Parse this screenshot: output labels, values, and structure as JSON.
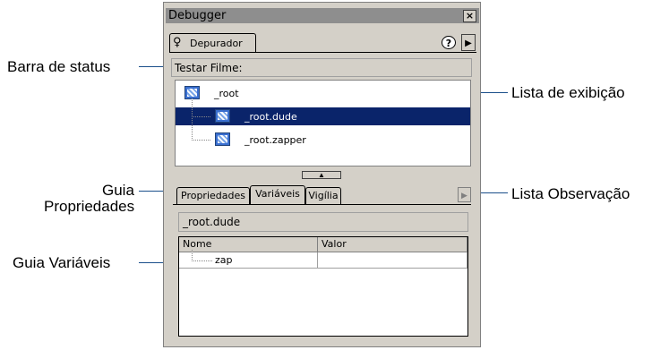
{
  "callouts": {
    "barra_status": "Barra de status",
    "lista_exibicao": "Lista de exibição",
    "guia_propriedades_line1": "Guia",
    "guia_propriedades_line2": "Propriedades",
    "lista_observacao": "Lista Observação",
    "guia_variaveis": "Guia Variáveis"
  },
  "window": {
    "title": "Debugger",
    "close_glyph": "×",
    "tab_label": "Depurador",
    "help_glyph": "?",
    "menu_glyph": "▶"
  },
  "status_bar": {
    "text": "Testar Filme:"
  },
  "display_list": {
    "items": [
      {
        "label": "_root",
        "selected": false
      },
      {
        "label": "_root.dude",
        "selected": true
      },
      {
        "label": "_root.zapper",
        "selected": false
      }
    ]
  },
  "splitter_glyph": "▲",
  "tabs": [
    {
      "label": "Propriedades",
      "active": false
    },
    {
      "label": "Variáveis",
      "active": true
    },
    {
      "label": "Vigília",
      "active": false
    }
  ],
  "tabs_scroll_glyph": "▶",
  "target_path": "_root.dude",
  "variables_table": {
    "columns": [
      "Nome",
      "Valor"
    ],
    "rows": [
      {
        "name": "zap",
        "value": ""
      }
    ]
  },
  "colors": {
    "leader_line": "#1a4f8a",
    "selection": "#0a246a",
    "panel_bg": "#d4d0c8"
  }
}
